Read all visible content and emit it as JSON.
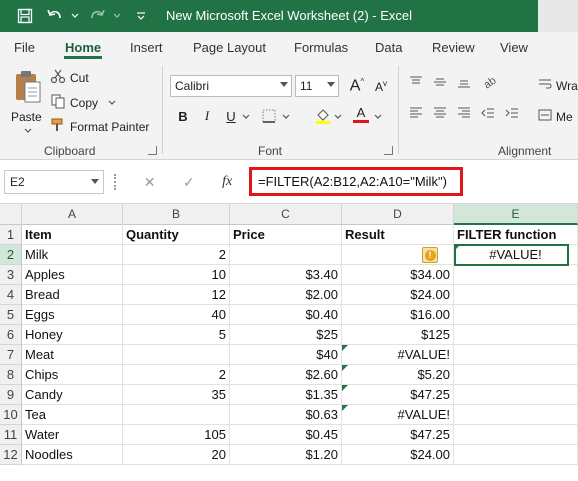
{
  "titlebar": {
    "title": "New Microsoft Excel Worksheet (2)  -  Excel"
  },
  "tabs": [
    "File",
    "Home",
    "Insert",
    "Page Layout",
    "Formulas",
    "Data",
    "Review",
    "View"
  ],
  "ribbon": {
    "clipboard": {
      "paste": "Paste",
      "cut": "Cut",
      "copy": "Copy",
      "format_painter": "Format Painter",
      "label": "Clipboard"
    },
    "font": {
      "font_name": "Calibri",
      "font_size": "11",
      "label": "Font",
      "bold": "B",
      "italic": "I",
      "underline": "U",
      "font_color": "A"
    },
    "alignment": {
      "wrap": "Wra",
      "merge": "Me",
      "label": "Alignment"
    }
  },
  "formula_bar": {
    "name_box": "E2",
    "fx": "fx",
    "formula": "=FILTER(A2:B12,A2:A10=\"Milk\")"
  },
  "columns": [
    "A",
    "B",
    "C",
    "D",
    "E"
  ],
  "rows": [
    "1",
    "2",
    "3",
    "4",
    "5",
    "6",
    "7",
    "8",
    "9",
    "10",
    "11",
    "12"
  ],
  "sheet": {
    "headers": {
      "a": "Item",
      "b": "Quantity",
      "c": "Price",
      "d": "Result",
      "e": "FILTER function"
    },
    "data": [
      {
        "a": "Milk",
        "b": "2",
        "c": "",
        "d": "",
        "e": "#VALUE!"
      },
      {
        "a": "Apples",
        "b": "10",
        "c": "$3.40",
        "d": "$34.00",
        "e": ""
      },
      {
        "a": "Bread",
        "b": "12",
        "c": "$2.00",
        "d": "$24.00",
        "e": ""
      },
      {
        "a": "Eggs",
        "b": "40",
        "c": "$0.40",
        "d": "$16.00",
        "e": ""
      },
      {
        "a": "Honey",
        "b": "5",
        "c": "$25",
        "d": "$125",
        "e": ""
      },
      {
        "a": "Meat",
        "b": "",
        "c": "$40",
        "d": "#VALUE!",
        "e": ""
      },
      {
        "a": "Chips",
        "b": "2",
        "c": "$2.60",
        "d": "$5.20",
        "e": ""
      },
      {
        "a": "Candy",
        "b": "35",
        "c": "$1.35",
        "d": "$47.25",
        "e": ""
      },
      {
        "a": "Tea",
        "b": "",
        "c": "$0.63",
        "d": "#VALUE!",
        "e": ""
      },
      {
        "a": "Water",
        "b": "105",
        "c": "$0.45",
        "d": "$47.25",
        "e": ""
      },
      {
        "a": "Noodles",
        "b": "20",
        "c": "$1.20",
        "d": "$24.00",
        "e": ""
      }
    ]
  },
  "colors": {
    "excel_green": "#217346",
    "formula_highlight": "#e0161b"
  }
}
